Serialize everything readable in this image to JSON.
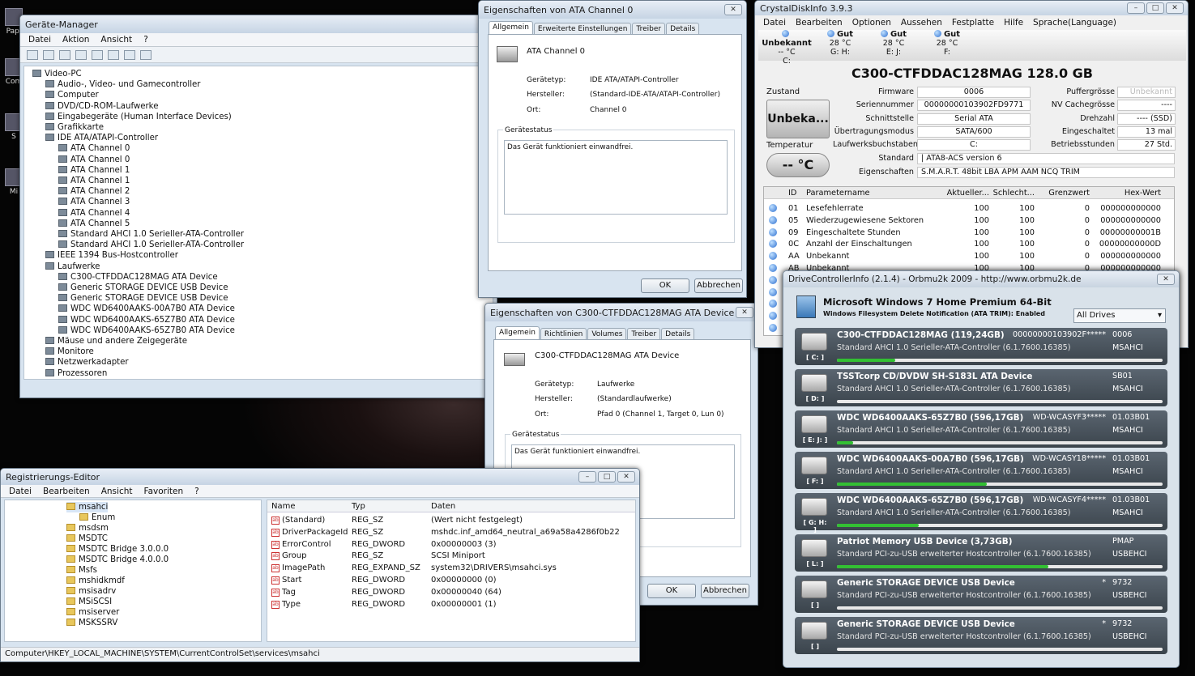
{
  "desktop": {
    "icons": [
      "Papi",
      "Com",
      "S",
      "Mi"
    ]
  },
  "devmgr": {
    "title": "Geräte-Manager",
    "menu": [
      "Datei",
      "Aktion",
      "Ansicht",
      "?"
    ],
    "tree": [
      {
        "t": "Video-PC",
        "l": 0
      },
      {
        "t": "Audio-, Video- und Gamecontroller",
        "l": 1
      },
      {
        "t": "Computer",
        "l": 1
      },
      {
        "t": "DVD/CD-ROM-Laufwerke",
        "l": 1
      },
      {
        "t": "Eingabegeräte (Human Interface Devices)",
        "l": 1
      },
      {
        "t": "Grafikkarte",
        "l": 1
      },
      {
        "t": "IDE ATA/ATAPI-Controller",
        "l": 1
      },
      {
        "t": "ATA Channel 0",
        "l": 2
      },
      {
        "t": "ATA Channel 0",
        "l": 2
      },
      {
        "t": "ATA Channel 1",
        "l": 2
      },
      {
        "t": "ATA Channel 1",
        "l": 2
      },
      {
        "t": "ATA Channel 2",
        "l": 2
      },
      {
        "t": "ATA Channel 3",
        "l": 2
      },
      {
        "t": "ATA Channel 4",
        "l": 2
      },
      {
        "t": "ATA Channel 5",
        "l": 2
      },
      {
        "t": "Standard AHCI 1.0 Serieller-ATA-Controller",
        "l": 2
      },
      {
        "t": "Standard AHCI 1.0 Serieller-ATA-Controller",
        "l": 2
      },
      {
        "t": "IEEE 1394 Bus-Hostcontroller",
        "l": 1
      },
      {
        "t": "Laufwerke",
        "l": 1
      },
      {
        "t": "C300-CTFDDAC128MAG ATA Device",
        "l": 2
      },
      {
        "t": "Generic STORAGE DEVICE USB Device",
        "l": 2
      },
      {
        "t": "Generic STORAGE DEVICE USB Device",
        "l": 2
      },
      {
        "t": "WDC WD6400AAKS-00A7B0 ATA Device",
        "l": 2
      },
      {
        "t": "WDC WD6400AAKS-65Z7B0 ATA Device",
        "l": 2
      },
      {
        "t": "WDC WD6400AAKS-65Z7B0 ATA Device",
        "l": 2
      },
      {
        "t": "Mäuse und andere Zeigegeräte",
        "l": 1
      },
      {
        "t": "Monitore",
        "l": 1
      },
      {
        "t": "Netzwerkadapter",
        "l": 1
      },
      {
        "t": "Prozessoren",
        "l": 1
      }
    ]
  },
  "dlg1": {
    "title": "Eigenschaften von ATA Channel 0",
    "tabs": [
      "Allgemein",
      "Erweiterte Einstellungen",
      "Treiber",
      "Details"
    ],
    "name": "ATA Channel 0",
    "k1": "Gerätetyp:",
    "v1": "IDE ATA/ATAPI-Controller",
    "k2": "Hersteller:",
    "v2": "(Standard-IDE-ATA/ATAPI-Controller)",
    "k3": "Ort:",
    "v3": "Channel 0",
    "status_label": "Gerätestatus",
    "status": "Das Gerät funktioniert einwandfrei.",
    "ok": "OK",
    "cancel": "Abbrechen"
  },
  "dlg2": {
    "title": "Eigenschaften von C300-CTFDDAC128MAG ATA Device",
    "tabs": [
      "Allgemein",
      "Richtlinien",
      "Volumes",
      "Treiber",
      "Details"
    ],
    "name": "C300-CTFDDAC128MAG ATA Device",
    "k1": "Gerätetyp:",
    "v1": "Laufwerke",
    "k2": "Hersteller:",
    "v2": "(Standardlaufwerke)",
    "k3": "Ort:",
    "v3": "Pfad 0 (Channel 1, Target 0, Lun 0)",
    "status_label": "Gerätestatus",
    "status": "Das Gerät funktioniert einwandfrei.",
    "ok": "OK",
    "cancel": "Abbrechen"
  },
  "cdi": {
    "title": "CrystalDiskInfo 3.9.3",
    "menu": [
      "Datei",
      "Bearbeiten",
      "Optionen",
      "Aussehen",
      "Festplatte",
      "Hilfe",
      "Sprache(Language)"
    ],
    "drives": [
      {
        "s": "Unbekannt",
        "t": "-- °C",
        "l": "C:"
      },
      {
        "s": "Gut",
        "t": "28 °C",
        "l": "G: H:"
      },
      {
        "s": "Gut",
        "t": "28 °C",
        "l": "E: J:"
      },
      {
        "s": "Gut",
        "t": "28 °C",
        "l": "F:"
      }
    ],
    "model": "C300-CTFDDAC128MAG  128.0 GB",
    "zustand_label": "Zustand",
    "zustand": "Unbeka...",
    "temp_label": "Temperatur",
    "temp": "-- °C",
    "left": [
      [
        "Firmware",
        "0006"
      ],
      [
        "Seriennummer",
        "00000000103902FD9771"
      ],
      [
        "Schnittstelle",
        "Serial ATA"
      ],
      [
        "Übertragungsmodus",
        "SATA/600"
      ],
      [
        "Laufwerksbuchstaben",
        "C:"
      ]
    ],
    "right": [
      [
        "Puffergrösse",
        "Unbekannt"
      ],
      [
        "NV Cachegrösse",
        "----"
      ],
      [
        "Drehzahl",
        "---- (SSD)"
      ],
      [
        "Eingeschaltet",
        "13 mal"
      ],
      [
        "Betriebsstunden",
        "27 Std."
      ]
    ],
    "standard_label": "Standard",
    "standard": "| ATA8-ACS version 6",
    "features_label": "Eigenschaften",
    "features": "S.M.A.R.T.  48bit LBA  APM  AAM  NCQ  TRIM",
    "smart_headers": [
      "ID",
      "Parametername",
      "Aktueller...",
      "Schlecht...",
      "Grenzwert",
      "Hex-Wert"
    ],
    "smart": [
      [
        "01",
        "Lesefehlerrate",
        "100",
        "100",
        "0",
        "000000000000"
      ],
      [
        "05",
        "Wiederzugewiesene Sektoren",
        "100",
        "100",
        "0",
        "000000000000"
      ],
      [
        "09",
        "Eingeschaltete Stunden",
        "100",
        "100",
        "0",
        "00000000001B"
      ],
      [
        "0C",
        "Anzahl der Einschaltungen",
        "100",
        "100",
        "0",
        "00000000000D"
      ],
      [
        "AA",
        "Unbekannt",
        "100",
        "100",
        "0",
        "000000000000"
      ],
      [
        "AB",
        "Unbekannt",
        "100",
        "100",
        "0",
        "000000000000"
      ]
    ]
  },
  "dci": {
    "title": "DriveControllerInfo (2.1.4) - Orbmu2k 2009 - http://www.orbmu2k.de",
    "os": "Microsoft Windows 7 Home Premium  64-Bit",
    "trim": "Windows Filesystem Delete Notification (ATA TRIM): Enabled",
    "filter": "All Drives",
    "drives": [
      {
        "name": "C300-CTFDDAC128MAG  (119,24GB)",
        "serial": "00000000103902F*****",
        "fw": "0006",
        "ctrl": "Standard AHCI 1.0 Serieller-ATA-Controller (6.1.7600.16385)",
        "drv": "MSAHCI",
        "let": "[ C: ]",
        "fill": 0.18
      },
      {
        "name": "TSSTcorp CD/DVDW SH-S183L ATA Device",
        "serial": "",
        "fw": "SB01",
        "ctrl": "Standard AHCI 1.0 Serieller-ATA-Controller (6.1.7600.16385)",
        "drv": "MSAHCI",
        "let": "[ D: ]",
        "fill": 0.0
      },
      {
        "name": "WDC WD6400AAKS-65Z7B0  (596,17GB)",
        "serial": "WD-WCASYF3*****",
        "fw": "01.03B01",
        "ctrl": "Standard AHCI 1.0 Serieller-ATA-Controller (6.1.7600.16385)",
        "drv": "MSAHCI",
        "let": "[ E: J: ]",
        "fill": 0.05
      },
      {
        "name": "WDC WD6400AAKS-00A7B0  (596,17GB)",
        "serial": "WD-WCASY18*****",
        "fw": "01.03B01",
        "ctrl": "Standard AHCI 1.0 Serieller-ATA-Controller (6.1.7600.16385)",
        "drv": "MSAHCI",
        "let": "[ F: ]",
        "fill": 0.46
      },
      {
        "name": "WDC WD6400AAKS-65Z7B0  (596,17GB)",
        "serial": "WD-WCASYF4*****",
        "fw": "01.03B01",
        "ctrl": "Standard AHCI 1.0 Serieller-ATA-Controller (6.1.7600.16385)",
        "drv": "MSAHCI",
        "let": "[ G: H: ]",
        "fill": 0.25
      },
      {
        "name": "Patriot Memory USB Device  (3,73GB)",
        "serial": "",
        "fw": "PMAP",
        "ctrl": "Standard PCI-zu-USB erweiterter Hostcontroller (6.1.7600.16385)",
        "drv": "USBEHCI",
        "let": "[ L: ]",
        "fill": 0.65
      },
      {
        "name": "Generic STORAGE DEVICE USB Device",
        "serial": "*",
        "fw": "9732",
        "ctrl": "Standard PCI-zu-USB erweiterter Hostcontroller (6.1.7600.16385)",
        "drv": "USBEHCI",
        "let": "[ ]",
        "fill": 0.0
      },
      {
        "name": "Generic STORAGE DEVICE USB Device",
        "serial": "*",
        "fw": "9732",
        "ctrl": "Standard PCI-zu-USB erweiterter Hostcontroller (6.1.7600.16385)",
        "drv": "USBEHCI",
        "let": "[ ]",
        "fill": 0.0
      }
    ]
  },
  "reg": {
    "title": "Registrierungs-Editor",
    "menu": [
      "Datei",
      "Bearbeiten",
      "Ansicht",
      "Favoriten",
      "?"
    ],
    "keys": [
      "msahci",
      "Enum",
      "msdsm",
      "MSDTC",
      "MSDTC Bridge 3.0.0.0",
      "MSDTC Bridge 4.0.0.0",
      "Msfs",
      "mshidkmdf",
      "msisadrv",
      "MSiSCSI",
      "msiserver",
      "MSKSSRV"
    ],
    "cols": [
      "Name",
      "Typ",
      "Daten"
    ],
    "values": [
      [
        "(Standard)",
        "REG_SZ",
        "(Wert nicht festgelegt)"
      ],
      [
        "DriverPackageId",
        "REG_SZ",
        "mshdc.inf_amd64_neutral_a69a58a4286f0b22"
      ],
      [
        "ErrorControl",
        "REG_DWORD",
        "0x00000003 (3)"
      ],
      [
        "Group",
        "REG_SZ",
        "SCSI Miniport"
      ],
      [
        "ImagePath",
        "REG_EXPAND_SZ",
        "system32\\DRIVERS\\msahci.sys"
      ],
      [
        "Start",
        "REG_DWORD",
        "0x00000000 (0)"
      ],
      [
        "Tag",
        "REG_DWORD",
        "0x00000040 (64)"
      ],
      [
        "Type",
        "REG_DWORD",
        "0x00000001 (1)"
      ]
    ],
    "path": "Computer\\HKEY_LOCAL_MACHINE\\SYSTEM\\CurrentControlSet\\services\\msahci"
  }
}
